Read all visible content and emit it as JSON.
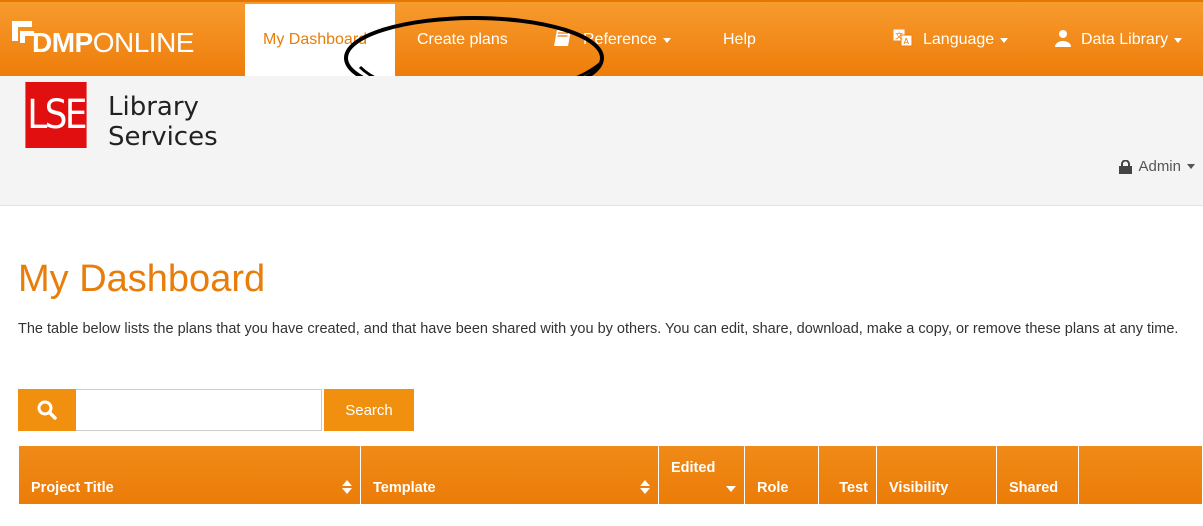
{
  "brand": {
    "bold": "DMP",
    "light": "ONLINE"
  },
  "nav": {
    "dashboard": "My Dashboard",
    "create": "Create plans",
    "reference": "Reference",
    "help": "Help",
    "language": "Language",
    "user": "Data Library"
  },
  "org": {
    "logo_text": "LSE",
    "name_line1": "Library",
    "name_line2": "Services",
    "admin": "Admin"
  },
  "page": {
    "title": "My Dashboard",
    "intro": "The table below lists the plans that you have created, and that have been shared with you by others. You can edit, share, download, make a copy, or remove these plans at any time."
  },
  "search": {
    "value": "",
    "button": "Search"
  },
  "table": {
    "headers": [
      "Project Title",
      "Template",
      "Edited",
      "Role",
      "Test",
      "Visibility",
      "Shared",
      ""
    ]
  },
  "colors": {
    "accent": "#ee7d0a",
    "lse_red": "#e10f0f",
    "annotation": "#000000"
  }
}
